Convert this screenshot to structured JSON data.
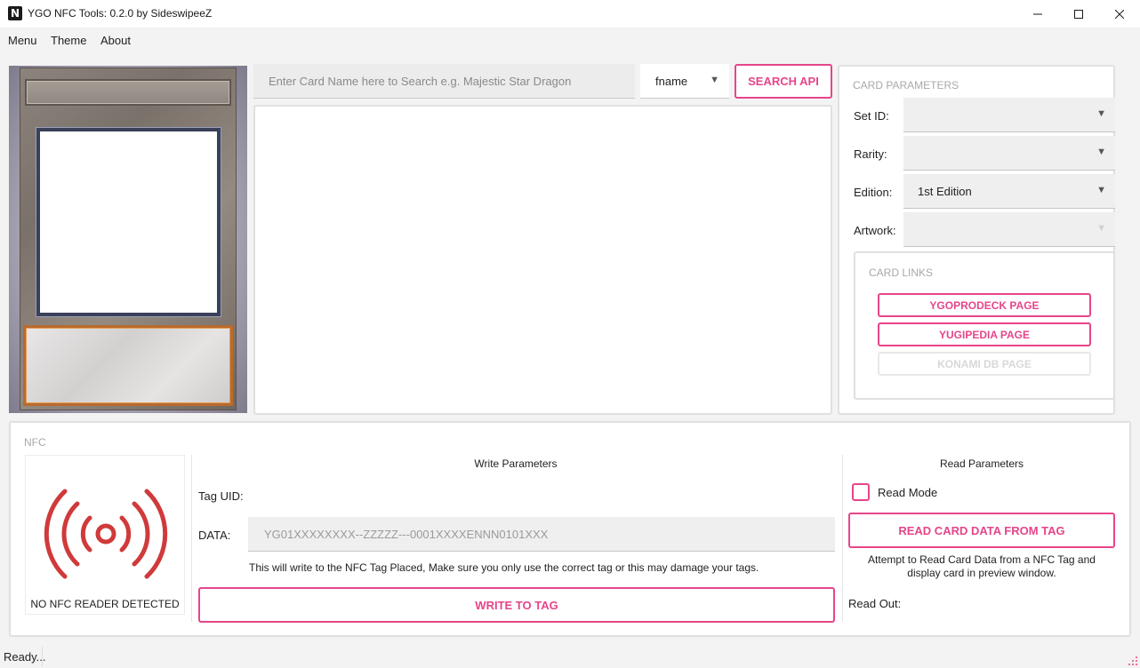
{
  "window": {
    "title": "YGO NFC Tools: 0.2.0 by SideswipeeZ",
    "icon_glyph": "N",
    "controls": [
      "minimize-icon",
      "maximize-icon",
      "close-icon"
    ]
  },
  "menu": {
    "items": [
      {
        "label": "Menu"
      },
      {
        "label": "Theme"
      },
      {
        "label": "About"
      }
    ]
  },
  "search": {
    "placeholder": "Enter Card Name here to Search e.g. Majestic Star Dragon",
    "type_value": "fname",
    "button_label": "SEARCH API"
  },
  "card_parameters": {
    "title": "CARD PARAMETERS",
    "fields": [
      {
        "label": "Set ID:",
        "value": ""
      },
      {
        "label": "Rarity:",
        "value": ""
      },
      {
        "label": "Edition:",
        "value": "1st Edition"
      },
      {
        "label": "Artwork:",
        "value": ""
      }
    ],
    "links": {
      "title": "CARD LINKS",
      "buttons": [
        {
          "label": "YGOPRODECK PAGE",
          "enabled": true
        },
        {
          "label": "YUGIPEDIA PAGE",
          "enabled": true
        },
        {
          "label": "KONAMI DB PAGE",
          "enabled": false
        }
      ]
    }
  },
  "nfc": {
    "title": "NFC",
    "status": "NO NFC READER DETECTED",
    "icon": "nfc-signal-icon",
    "icon_color": "#d03a3a",
    "write": {
      "title": "Write Parameters",
      "tag_uid_label": "Tag UID:",
      "data_label": "DATA:",
      "data_placeholder": "YG01XXXXXXXX--ZZZZZ---0001XXXXENNN0101XXX",
      "warning": "This will write to the NFC Tag Placed, Make sure you only use the correct tag or this may damage your tags.",
      "button_label": "WRITE TO TAG"
    },
    "read": {
      "title": "Read Parameters",
      "mode_label": "Read Mode",
      "mode_checked": false,
      "button_label": "READ CARD DATA FROM TAG",
      "description_line1": "Attempt to Read Card Data from a NFC Tag and",
      "description_line2": "display card in preview window.",
      "readout_label": "Read Out:"
    }
  },
  "status_bar": {
    "text": "Ready..."
  },
  "colors": {
    "accent": "#e6458a",
    "nfc_icon": "#d03a3a",
    "panel_border": "#e0e0e0"
  }
}
